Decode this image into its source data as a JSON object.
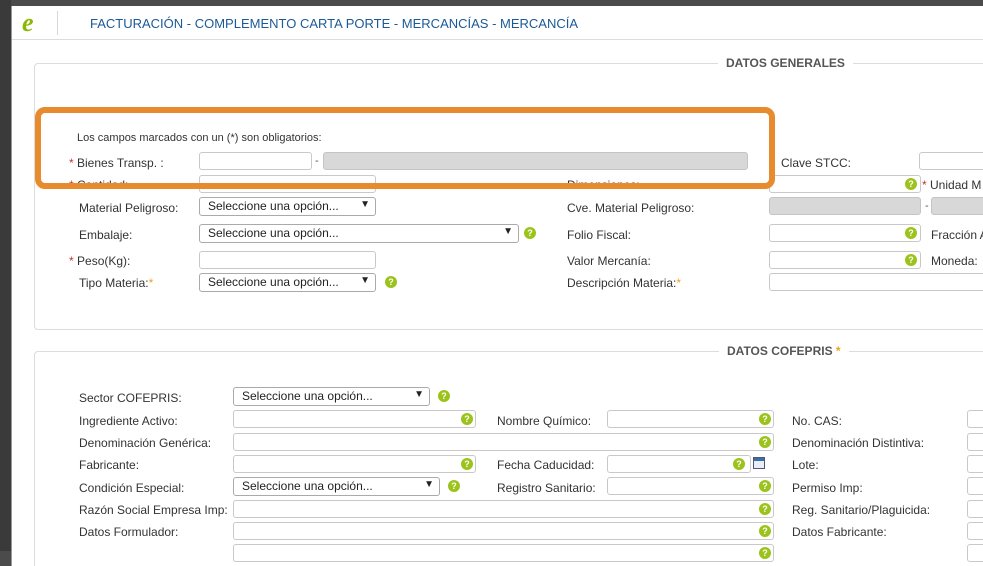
{
  "header": {
    "title": "FACTURACIÓN - COMPLEMENTO CARTA PORTE - MERCANCÍAS - MERCANCÍA"
  },
  "general": {
    "legend": "DATOS GENERALES",
    "note": "Los campos marcados con un (*) son obligatorios:",
    "bienes_label": "Bienes Transp. :",
    "clave_stcc_label": "Clave STCC:",
    "cantidad_label": "Cantidad:",
    "dimensiones_label": "Dimensiones:",
    "unidad_label": "Unidad M",
    "material_peligroso_label": "Material Peligroso:",
    "material_peligroso_value": "Seleccione una opción...",
    "cve_material_label": "Cve. Material Peligroso:",
    "embalaje_label": "Embalaje:",
    "embalaje_value": "Seleccione una opción...",
    "folio_fiscal_label": "Folio Fiscal:",
    "fraccion_label": "Fracción A",
    "peso_label": "Peso(Kg):",
    "valor_label": "Valor Mercanía:",
    "moneda_label": "Moneda:",
    "tipo_materia_label": "Tipo Materia:",
    "tipo_materia_value": "Seleccione una opción...",
    "descripcion_label": "Descripción Materia:"
  },
  "cofepris": {
    "legend": "DATOS COFEPRIS",
    "sector_label": "Sector COFEPRIS:",
    "sector_value": "Seleccione una opción...",
    "ingrediente_label": "Ingrediente Activo:",
    "nombre_quimico_label": "Nombre Químico:",
    "no_cas_label": "No. CAS:",
    "denominacion_generica_label": "Denominación Genérica:",
    "denominacion_distintiva_label": "Denominación Distintiva:",
    "fabricante_label": "Fabricante:",
    "fecha_caducidad_label": "Fecha Caducidad:",
    "lote_label": "Lote:",
    "condicion_label": "Condición Especial:",
    "condicion_value": "Seleccione una opción...",
    "registro_sanitario_label": "Registro Sanitario:",
    "permiso_label": "Permiso Imp:",
    "razon_social_label": "Razón Social Empresa Imp:",
    "reg_sanitario_plaguicida_label": "Reg. Sanitario/Plaguicida:",
    "datos_formulador_label": "Datos Formulador:",
    "datos_fabricante_label": "Datos Fabricante:"
  },
  "colors": {
    "accent": "#1a5a96",
    "help": "#9cc31c",
    "highlight": "#e88a2e",
    "required": "#c0392b"
  },
  "icons": {
    "help": "help-icon",
    "calendar": "calendar-icon",
    "dropdown": "chevron-down-icon"
  }
}
